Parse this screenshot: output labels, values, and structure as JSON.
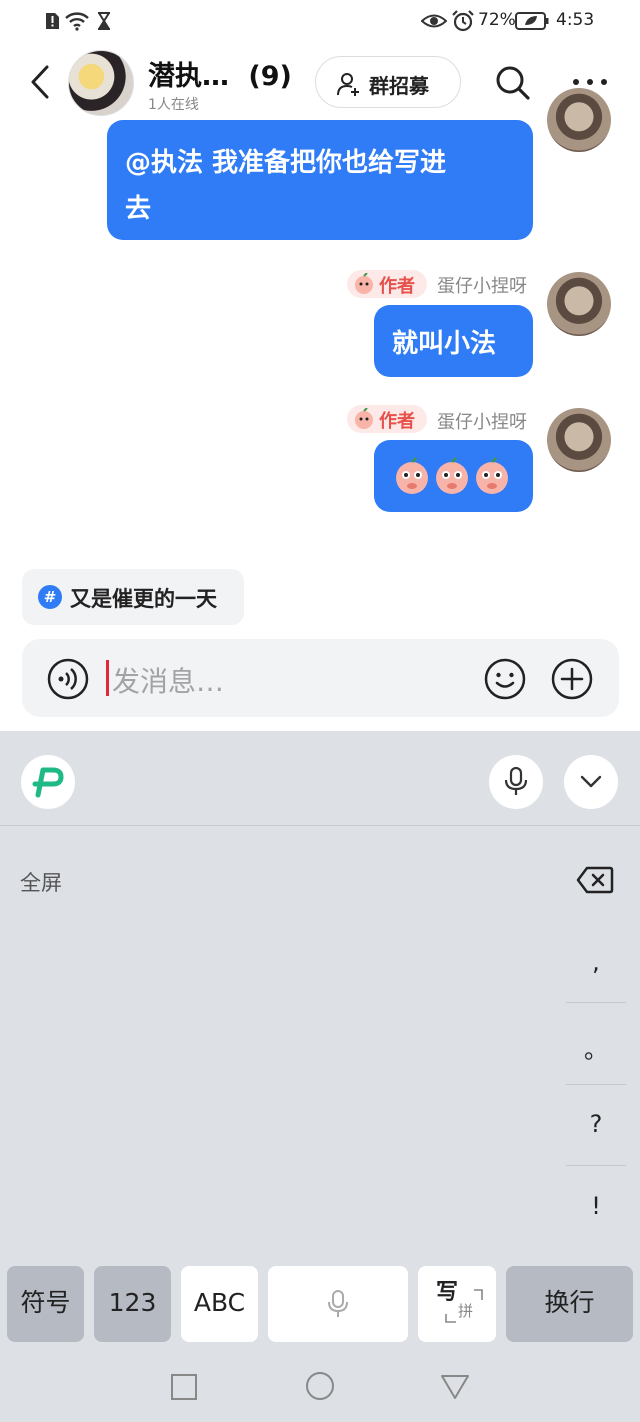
{
  "status_bar": {
    "battery": "72%",
    "time": "4:53"
  },
  "header": {
    "title": "潜执…",
    "member_count": "(9)",
    "subtitle": "1人在线",
    "recruit_label": "群招募"
  },
  "messages": [
    {
      "text": "@执法  我准备把你也给写进去",
      "line1": "@执法  我准备把你也给写进",
      "line2": "去"
    },
    {
      "badge": "作者",
      "sender": "蛋仔小捏呀",
      "text": "就叫小法"
    },
    {
      "badge": "作者",
      "sender": "蛋仔小捏呀",
      "text": "",
      "stickers": [
        "peach-sticker",
        "peach-sticker",
        "peach-sticker"
      ]
    }
  ],
  "topic": {
    "label": "又是催更的一天"
  },
  "input": {
    "placeholder": "发消息…"
  },
  "keyboard": {
    "fullscreen_label": "全屏",
    "punctuation": [
      ",",
      "。",
      "?",
      "!"
    ],
    "keys": {
      "symbols": "符号",
      "numbers": "123",
      "abc": "ABC",
      "write": "写",
      "pinyin": "拼",
      "enter": "换行"
    }
  },
  "colors": {
    "accent_blue": "#2f7cf6",
    "author_red": "#e6514a",
    "keyboard_bg": "#dde0e5",
    "brand_green": "#1fb985"
  }
}
